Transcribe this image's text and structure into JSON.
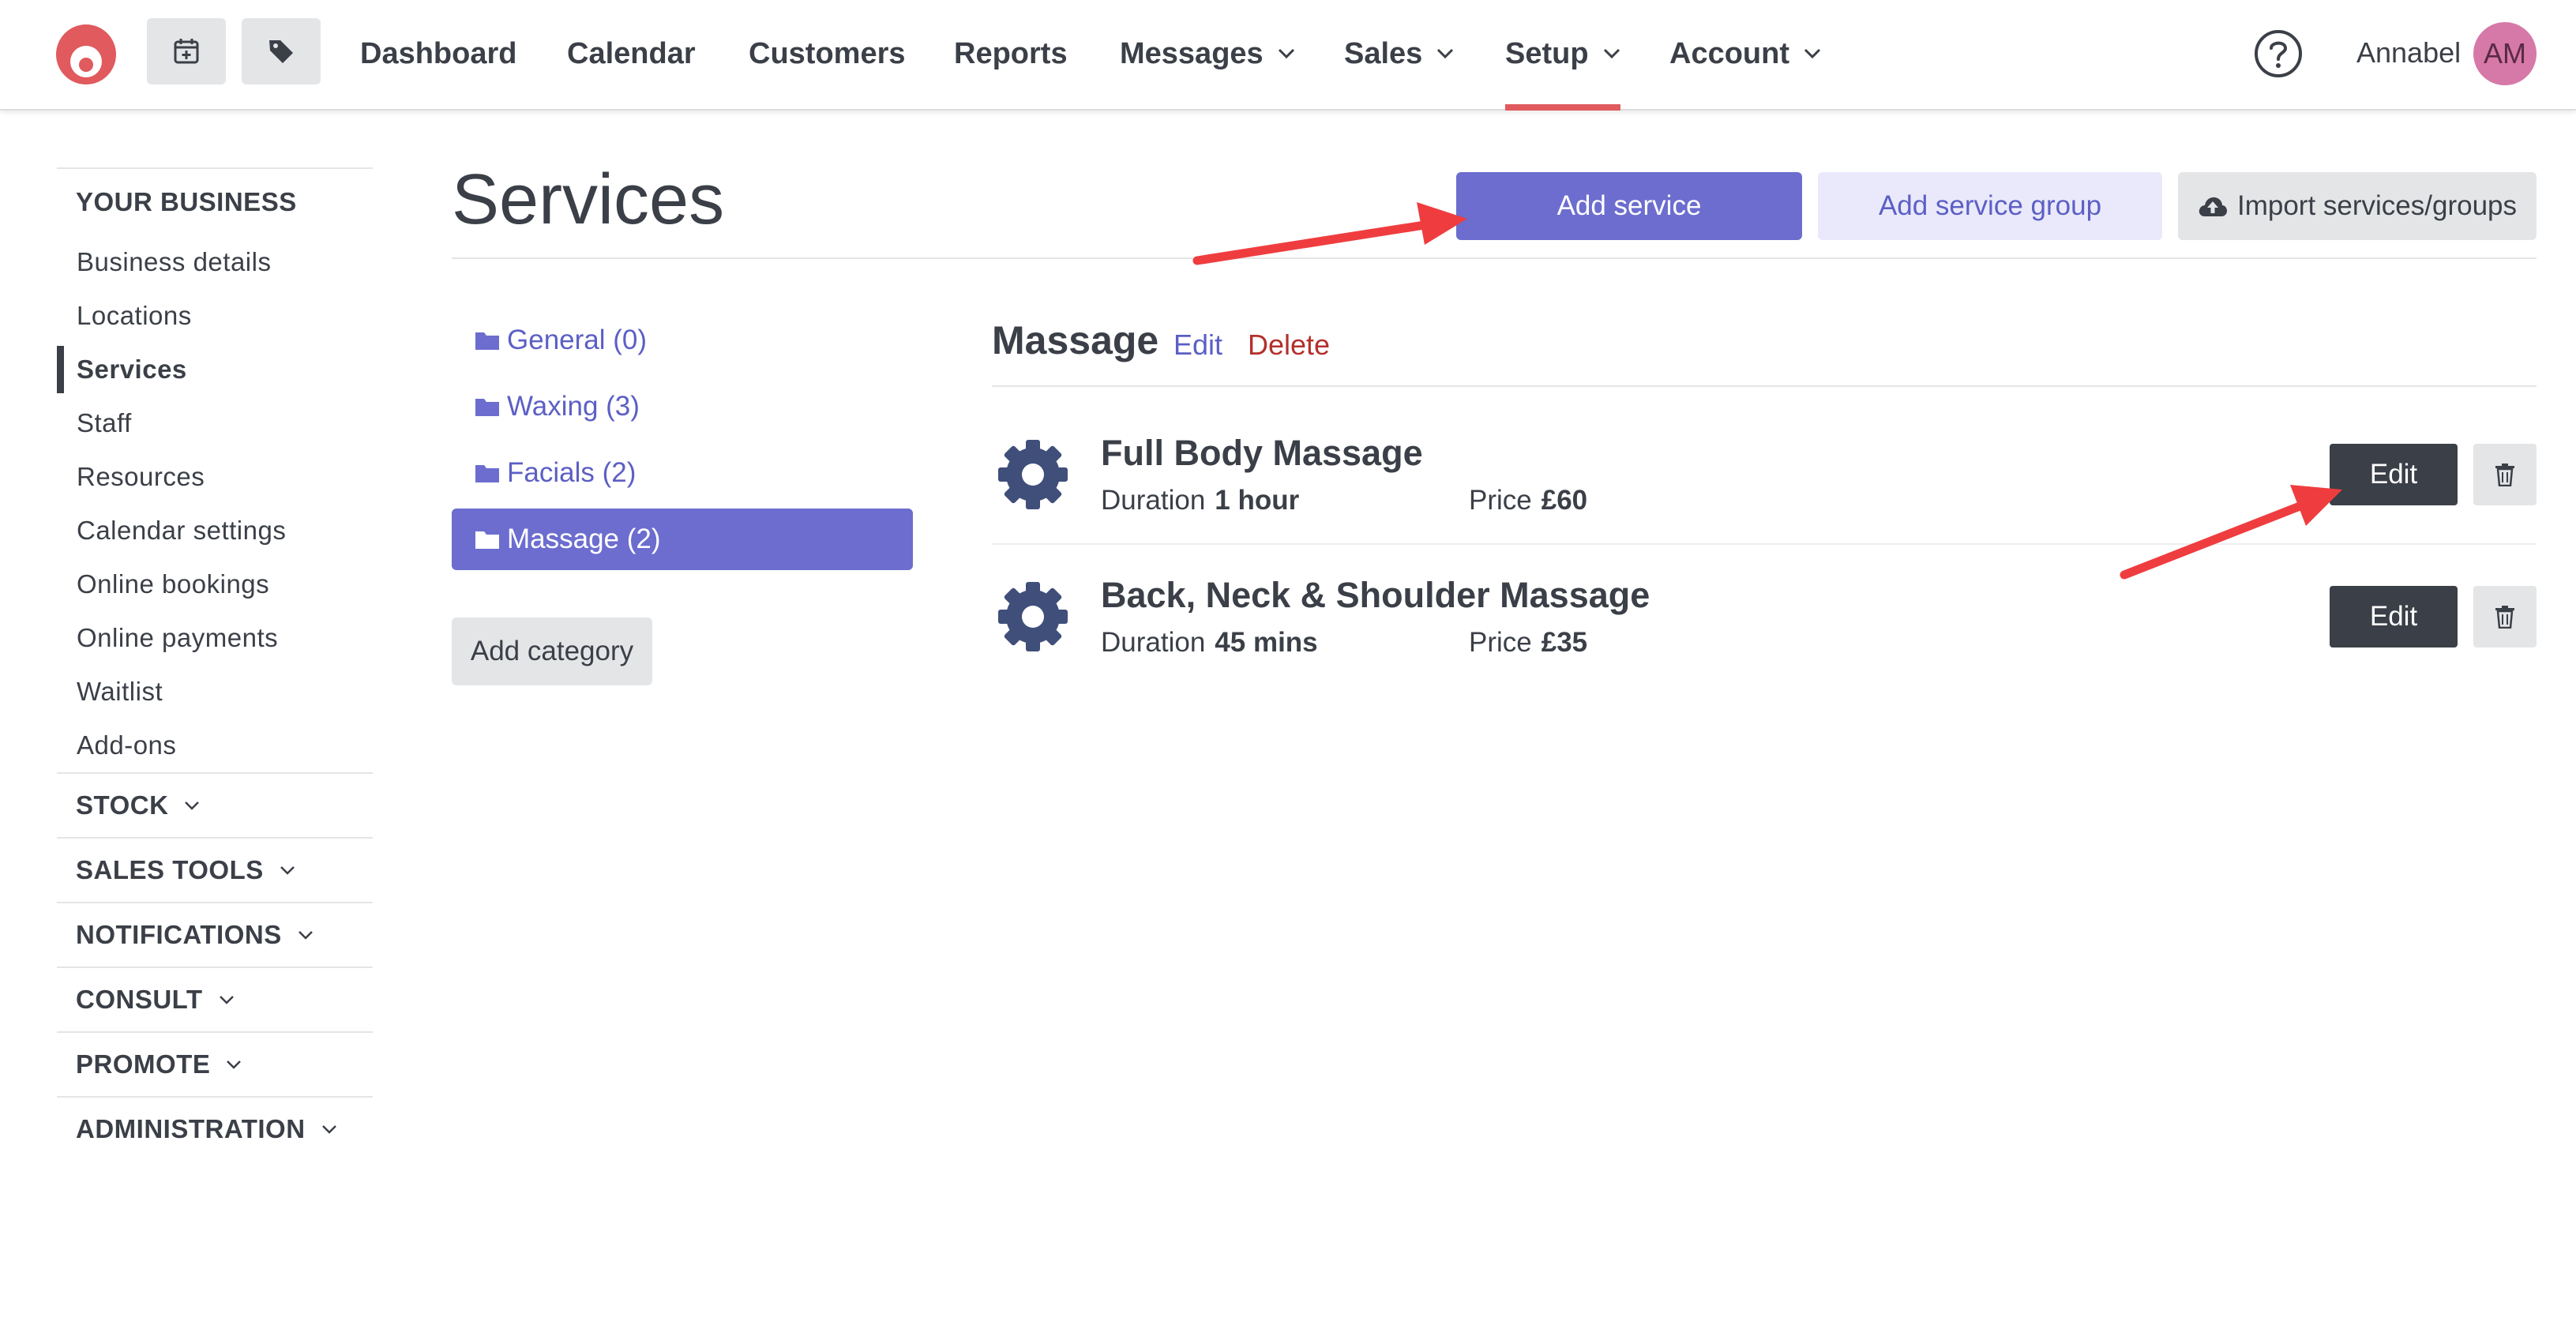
{
  "nav": {
    "items": [
      {
        "label": "Dashboard",
        "has_menu": false
      },
      {
        "label": "Calendar",
        "has_menu": false
      },
      {
        "label": "Customers",
        "has_menu": false
      },
      {
        "label": "Reports",
        "has_menu": false
      },
      {
        "label": "Messages",
        "has_menu": true
      },
      {
        "label": "Sales",
        "has_menu": true
      },
      {
        "label": "Setup",
        "has_menu": true,
        "active": true
      },
      {
        "label": "Account",
        "has_menu": true
      }
    ],
    "quick_actions": [
      "calendar-add-icon",
      "tag-icon"
    ],
    "help_icon": "question-circle-icon",
    "user_name": "Annabel",
    "avatar_initials": "AM",
    "colors": {
      "accent": "#6c6dcf",
      "active_underline": "#e05a5e",
      "avatar": "#d679a8",
      "logo": "#e05a5e"
    }
  },
  "sidebar": {
    "heading": "YOUR BUSINESS",
    "links": [
      {
        "label": "Business details"
      },
      {
        "label": "Locations"
      },
      {
        "label": "Services",
        "active": true
      },
      {
        "label": "Staff"
      },
      {
        "label": "Resources"
      },
      {
        "label": "Calendar settings"
      },
      {
        "label": "Online bookings"
      },
      {
        "label": "Online payments"
      },
      {
        "label": "Waitlist"
      },
      {
        "label": "Add-ons"
      }
    ],
    "sections": [
      {
        "label": "STOCK"
      },
      {
        "label": "SALES TOOLS"
      },
      {
        "label": "NOTIFICATIONS"
      },
      {
        "label": "CONSULT"
      },
      {
        "label": "PROMOTE"
      },
      {
        "label": "ADMINISTRATION"
      }
    ]
  },
  "page": {
    "title": "Services",
    "add_service": "Add service",
    "add_service_group": "Add service group",
    "import": "Import services/groups",
    "import_icon": "cloud-upload-icon"
  },
  "categories": {
    "items": [
      {
        "label": "General (0)"
      },
      {
        "label": "Waxing (3)"
      },
      {
        "label": "Facials (2)"
      },
      {
        "label": "Massage (2)",
        "active": true
      }
    ],
    "add_category": "Add category",
    "icon": "folder-icon"
  },
  "group": {
    "title": "Massage",
    "edit": "Edit",
    "delete": "Delete",
    "services": [
      {
        "name": "Full Body Massage",
        "duration_label": "Duration",
        "duration": "1 hour",
        "price_label": "Price",
        "price": "£60",
        "edit": "Edit"
      },
      {
        "name": "Back, Neck & Shoulder Massage",
        "duration_label": "Duration",
        "duration": "45 mins",
        "price_label": "Price",
        "price": "£35",
        "edit": "Edit"
      }
    ],
    "service_icon": "gear-icon",
    "delete_icon": "trash-icon"
  }
}
